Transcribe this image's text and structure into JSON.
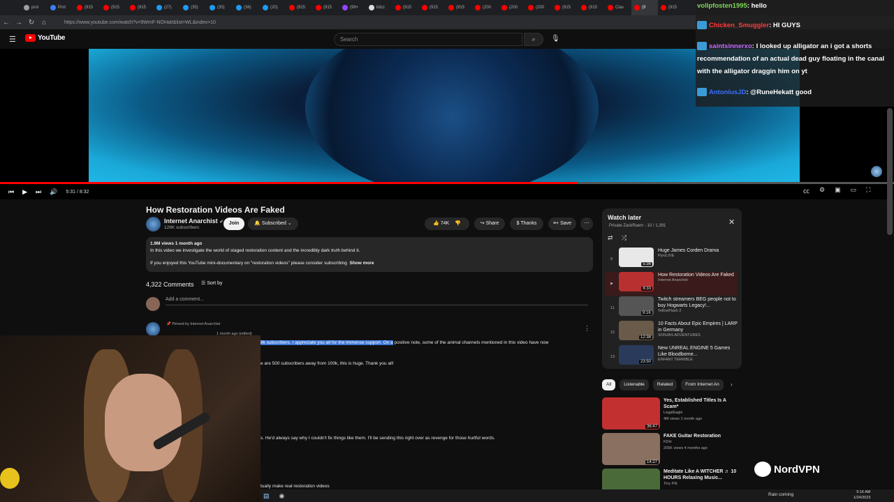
{
  "browser": {
    "tabs": [
      {
        "label": "prol",
        "color": "#9aa0a6"
      },
      {
        "label": "Prot",
        "color": "#3d7ef5"
      },
      {
        "label": "(915",
        "color": "#ff0000"
      },
      {
        "label": "(915",
        "color": "#ff0000"
      },
      {
        "label": "(915",
        "color": "#ff0000"
      },
      {
        "label": "(27)",
        "color": "#1d9bf0"
      },
      {
        "label": "(35)",
        "color": "#1d9bf0"
      },
      {
        "label": "(35)",
        "color": "#1d9bf0"
      },
      {
        "label": "(36)",
        "color": "#1d9bf0"
      },
      {
        "label": "(20)",
        "color": "#1d9bf0"
      },
      {
        "label": "(915",
        "color": "#ff0000"
      },
      {
        "label": "(915",
        "color": "#ff0000"
      },
      {
        "label": "(99+",
        "color": "#9146ff"
      },
      {
        "label": "blizz",
        "color": "#dddddd"
      },
      {
        "label": "(915",
        "color": "#ff0000"
      },
      {
        "label": "(915",
        "color": "#ff0000"
      },
      {
        "label": "(915",
        "color": "#ff0000"
      },
      {
        "label": "(200",
        "color": "#ff0000"
      },
      {
        "label": "(200",
        "color": "#ff0000"
      },
      {
        "label": "(200",
        "color": "#ff0000"
      },
      {
        "label": "(915",
        "color": "#ff0000"
      },
      {
        "label": "(915",
        "color": "#ff0000"
      },
      {
        "label": "Clas",
        "color": "#ff0000"
      },
      {
        "label": "(9",
        "color": "#ff0000"
      },
      {
        "label": "(915",
        "color": "#ff0000"
      }
    ],
    "url": "https://www.youtube.com/watch?v=9WmF-NOHatI&list=WL&index=10"
  },
  "youtube": {
    "logo_text": "YouTube",
    "search_placeholder": "Search"
  },
  "player": {
    "time": "5:31 / 8:32",
    "progress_fraction": 0.646
  },
  "video": {
    "title": "How Restoration Videos Are Faked",
    "channel": "Internet Anarchist",
    "verified_mark": "✔",
    "subscribers": "126K subscribers",
    "join_label": "Join",
    "subscribed_label": "Subscribed",
    "likes": "74K",
    "share_label": "Share",
    "thanks_label": "Thanks",
    "save_label": "Save"
  },
  "description": {
    "meta": "1.9M views  1 month ago",
    "line1": "In this video we investigate the world of staged restoration content and the incredibly dark truth behind it.",
    "line2": "If you enjoyed this YouTube mini-documentary on \"restoration videos\" please consider subscribing",
    "show_more": "Show more"
  },
  "comments": {
    "count": "4,322 Comments",
    "sort_label": "Sort by",
    "add_placeholder": "Add a comment...",
    "pinned_label": "Pinned by Internet Anarchist",
    "time": "1 month ago (edited)",
    "highlighted": "8k subscribers. I appreciate you all for the immense support. On a",
    "text1_rest": " positive note, some of the animal channels mentioned in this video have now",
    "text2": "e are 500 subscribers away from 100k, this is huge. Thank you all!",
    "text3": "s. He'd always say why I couldn't fix things like them. I'll be sending this right over as revenge for those hurtful words.",
    "text4": "tually make real restoration videos"
  },
  "watch_later": {
    "title": "Watch later",
    "subtitle": "Private  ZackRawrr - 10 / 1,391",
    "items": [
      {
        "index": "9",
        "title": "Huge James Corden Drama",
        "channel": "PyroLIVE",
        "duration": "5:36",
        "thumb_color": "#e8e8e8",
        "current": false
      },
      {
        "index": "▶",
        "title": "How Restoration Videos Are Faked",
        "channel": "Internet Anarchist",
        "duration": "8:33",
        "thumb_color": "#b83030",
        "current": true
      },
      {
        "index": "11",
        "title": "Twitch streamers BEG people not to buy Hogwarts Legacy!...",
        "channel": "YellowFlash 2",
        "duration": "9:16",
        "thumb_color": "#555555",
        "current": false
      },
      {
        "index": "12",
        "title": "10 Facts About Epic Empires | LARP in Germany",
        "channel": "SONJAS ADVENTURES",
        "duration": "12:38",
        "thumb_color": "#6a5a4a",
        "current": false
      },
      {
        "index": "13",
        "title": "New UNREAL ENGINE 5 Games Like Bloodborne...",
        "channel": "ENFANT TERRIBLE",
        "duration": "23:50",
        "thumb_color": "#2a3a5a",
        "current": false
      }
    ]
  },
  "chips": [
    "All",
    "Listenable",
    "Related",
    "From Internet An"
  ],
  "recommendations": [
    {
      "title": "Yes, Established Titles Is A Scam*",
      "channel": "LegalEagle",
      "meta": "4M views  1 month ago",
      "duration": "36:47",
      "thumb_color": "#c23030"
    },
    {
      "title": "FAKE Guitar Restoration",
      "channel": "KDH",
      "meta": "205K views  4 months ago",
      "duration": "14:27",
      "thumb_color": "#8a7060"
    },
    {
      "title": "Meditate Like A WITCHER ♬ 10 HOURS Relaxing Music...",
      "channel": "Tiny Pitt",
      "meta": "",
      "duration": "",
      "thumb_color": "#4a6a3a"
    }
  ],
  "chat": [
    {
      "user": "vollpfosten1995",
      "message": "hello",
      "color": "#7ed957"
    },
    {
      "user": "Chicken_Smuggler",
      "message": "HI GUYS",
      "color": "#ff3b3b"
    },
    {
      "user": "saintsinnerxo",
      "message": "I looked up alligator an i got a shorts recommendation of an actual dead guy floating in the canal with the alligator draggin him on yt",
      "color": "#c070ff"
    },
    {
      "user": "AntoniusJD",
      "message": "@RuneHekatt good",
      "color": "#3d6fff"
    }
  ],
  "overlay": {
    "sponsor": "NordVPN"
  },
  "taskbar": {
    "weather": "Rain coming",
    "time": "9:16 AM",
    "date": "1/24/2023"
  },
  "colors": {
    "accent_red": "#ff0000",
    "bg": "#0f0f0f",
    "highlight": "#3d78d8"
  }
}
